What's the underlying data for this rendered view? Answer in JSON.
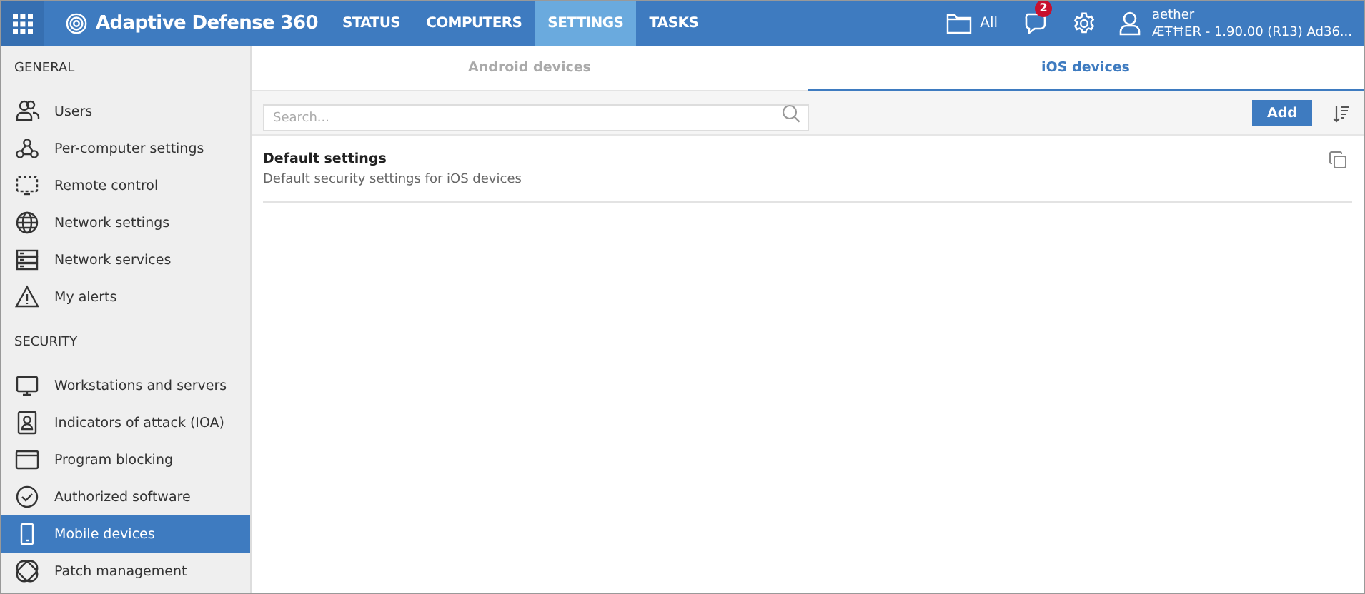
{
  "app": {
    "title": "Adaptive Defense 360"
  },
  "nav": [
    {
      "label": "STATUS",
      "selected": false
    },
    {
      "label": "COMPUTERS",
      "selected": false
    },
    {
      "label": "SETTINGS",
      "selected": true
    },
    {
      "label": "TASKS",
      "selected": false
    }
  ],
  "header": {
    "filter": "All",
    "notifications": "2",
    "user": "aether",
    "account": "ÆŦĦER - 1.90.00 (R13) Ad36..."
  },
  "sidebar": [
    {
      "heading": "GENERAL",
      "items": [
        {
          "label": "Users",
          "selected": false
        },
        {
          "label": "Per-computer settings",
          "selected": false
        },
        {
          "label": "Remote control",
          "selected": false
        },
        {
          "label": "Network settings",
          "selected": false
        },
        {
          "label": "Network services",
          "selected": false
        },
        {
          "label": "My alerts",
          "selected": false
        }
      ]
    },
    {
      "heading": "SECURITY",
      "items": [
        {
          "label": "Workstations and servers",
          "selected": false
        },
        {
          "label": "Indicators of attack (IOA)",
          "selected": false
        },
        {
          "label": "Program blocking",
          "selected": false
        },
        {
          "label": "Authorized software",
          "selected": false
        },
        {
          "label": "Mobile devices",
          "selected": true
        },
        {
          "label": "Patch management",
          "selected": false
        }
      ]
    }
  ],
  "tabs": [
    {
      "label": "Android devices",
      "selected": false
    },
    {
      "label": "iOS devices",
      "selected": true
    }
  ],
  "search": {
    "placeholder": "Search..."
  },
  "add_button": "Add",
  "settings": [
    {
      "title": "Default settings",
      "description": "Default security settings for iOS devices"
    }
  ]
}
